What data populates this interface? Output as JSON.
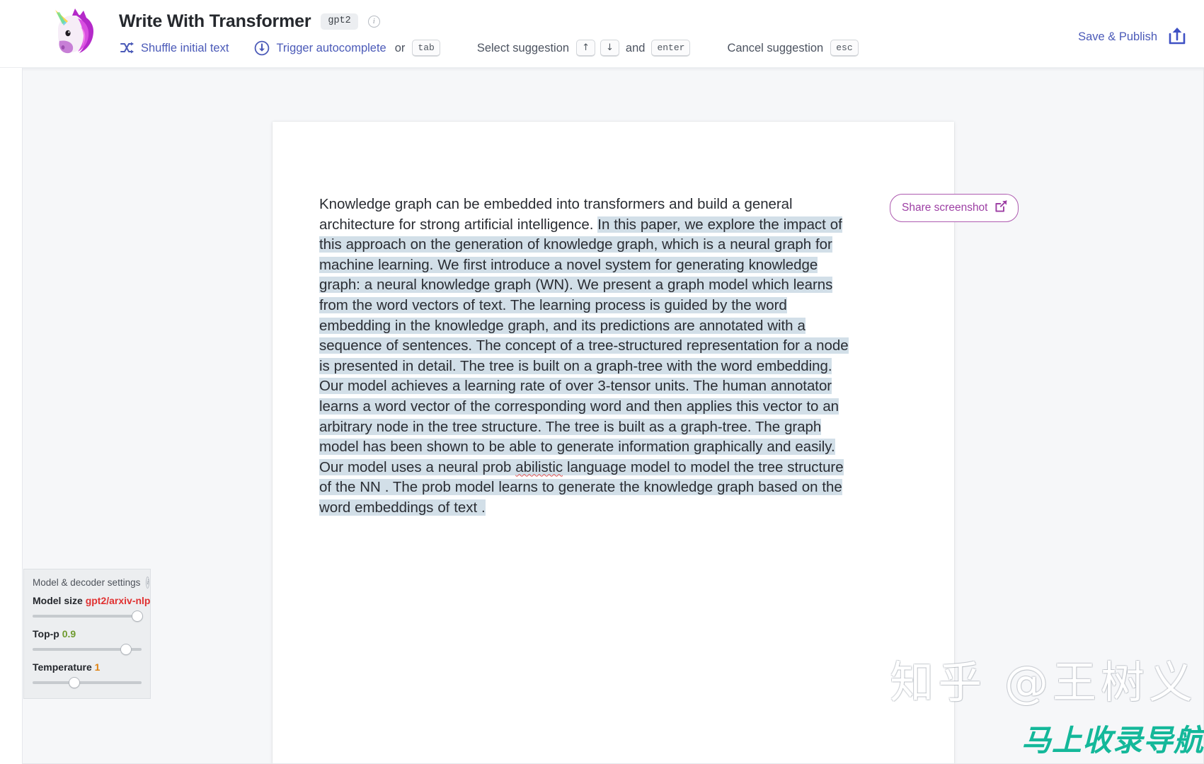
{
  "header": {
    "logo_icon": "unicorn-logo",
    "title": "Write With Transformer",
    "model_badge": "gpt2",
    "info_icon": "info-icon",
    "shortcuts": {
      "shuffle_icon": "shuffle-icon",
      "shuffle_label": "Shuffle initial text",
      "trigger_icon": "download-arrow-icon",
      "trigger_label": "Trigger autocomplete",
      "or_label": "or",
      "tab_key": "tab",
      "select_label": "Select suggestion",
      "arrow_up_key": "↑",
      "arrow_down_key": "↓",
      "and_label": "and",
      "enter_key": "enter",
      "cancel_label": "Cancel suggestion",
      "esc_key": "esc"
    },
    "save_publish_label": "Save & Publish",
    "save_publish_icon": "share-upload-icon"
  },
  "share": {
    "label": "Share screenshot",
    "icon": "external-link-icon"
  },
  "document": {
    "seed_1": "Knowledge graph can be embedded into transformers and build a general architecture for strong artificial intelligence. ",
    "generated_a": " In this paper, we explore the impact of this approach on the generation of knowledge graph, which is a neural graph for machine learning. We first introduce a novel system for generating knowledge graph: a neural knowledge graph (WN).  We present a graph model which learns from the word vectors of text. The learning process is guided by the word embedding in the knowledge graph, and its predictions are annotated with  a sequence of sentences. The concept of a tree-structured representation for a node is presented in detail. The tree is built on a graph-tree with the word embedding. Our model achieves a learning rate of over 3-tensor units. The human annotator learns a word vector of the corresponding  word and then applies this vector to an arbitrary node in the tree structure. The tree is built as a graph-tree. The graph model has been shown to be able to generate information graphically and easily. Our model uses a neural prob ",
    "misspelled_word": "abilistic",
    "generated_b": " language model to model the tree structure of the NN . The prob model learns  to generate the knowledge graph based on the word embeddings of text ."
  },
  "settings": {
    "panel_title": "Model & decoder settings",
    "info_icon": "info-icon",
    "items": [
      {
        "label": "Model size",
        "value": "gpt2/arxiv-nlp",
        "thumb_pct": 96
      },
      {
        "label": "Top-p",
        "value": "0.9",
        "thumb_pct": 86
      },
      {
        "label": "Temperature",
        "value": "1",
        "thumb_pct": 38
      }
    ]
  },
  "watermarks": {
    "zhihu": "知乎 @王树义",
    "nav": "马上收录导航"
  },
  "colors": {
    "accent_blue": "#4b5ab8",
    "highlight": "#d2dfe8",
    "share_purple": "#9d3fa4",
    "model_red": "#e03131",
    "topp_green": "#6f9a2e",
    "temp_orange": "#e0820f",
    "nav_teal": "#14b89a"
  }
}
